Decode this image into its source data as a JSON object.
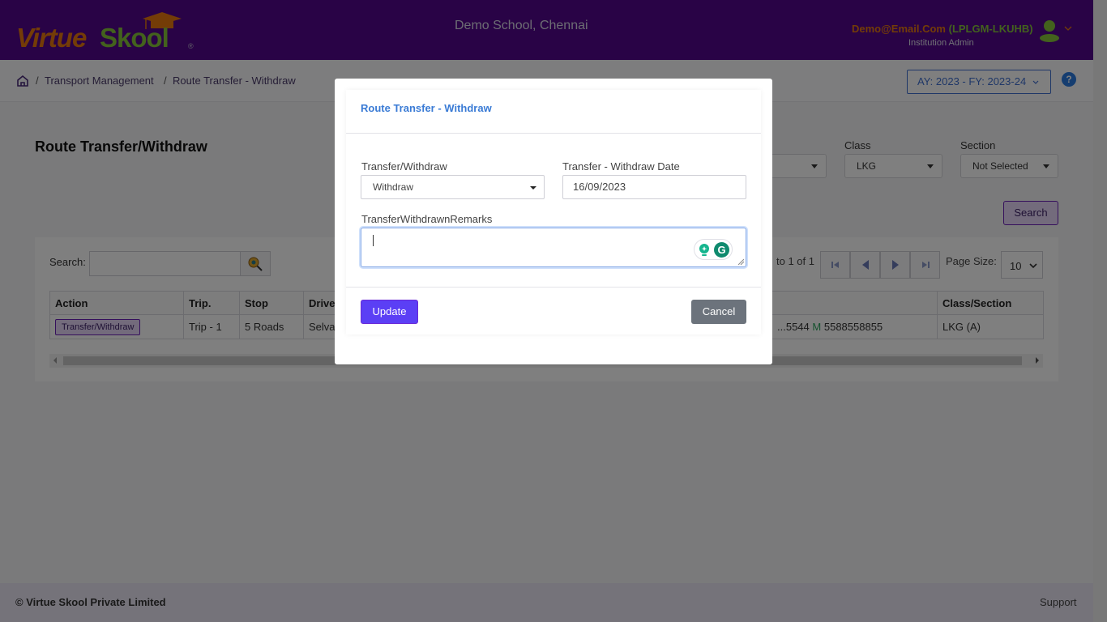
{
  "header": {
    "logo_part1": "Virtue",
    "logo_part2": "Skool",
    "logo_reg": "®",
    "school_name": "Demo School, Chennai",
    "user_email": "Demo@Email.Com",
    "user_code": "(LPLGM-LKUHB)",
    "user_role": "Institution Admin",
    "colors": {
      "topbar": "#52078c",
      "brand_orange": "#e8780f",
      "brand_green": "#86c53a"
    }
  },
  "breadcrumb": {
    "items": [
      "Transport Management",
      "Route Transfer - Withdraw"
    ],
    "separator": "/"
  },
  "academic_year": "AY: 2023 - FY: 2023-24",
  "help_label": "?",
  "page": {
    "title": "Route Transfer/Withdraw",
    "filters": {
      "class_label": "Class",
      "class_value": "LKG",
      "section_label": "Section",
      "section_value": "Not Selected"
    },
    "search_button": "Search"
  },
  "grid": {
    "search_label": "Search:",
    "search_value": "",
    "paging_text": "to 1 of 1",
    "page_size_label": "Page Size:",
    "page_size_value": "10",
    "columns": [
      "Action",
      "Trip.",
      "Stop",
      "Driver",
      "",
      "Class/Section"
    ],
    "rows": [
      {
        "action": "Transfer/Withdraw",
        "trip": "Trip - 1",
        "stop": "5 Roads",
        "driver": "Selvam",
        "contact_prefix": "...5544",
        "contact_m": "M",
        "contact_mobile": "5588558855",
        "class_section": "LKG (A)"
      }
    ]
  },
  "modal": {
    "title": "Route Transfer - Withdraw",
    "type_label": "Transfer/Withdraw",
    "type_value": "Withdraw",
    "date_label": "Transfer - Withdraw Date",
    "date_value": "16/09/2023",
    "remarks_label": "TransferWithdrawnRemarks",
    "remarks_value": "",
    "update_button": "Update",
    "cancel_button": "Cancel",
    "grammarly_letter": "G",
    "colors": {
      "title": "#3a7bd5",
      "update": "#5b3ff5",
      "cancel": "#6c737c"
    }
  },
  "footer": {
    "copyright": "© Virtue Skool Private Limited",
    "support": "Support"
  }
}
